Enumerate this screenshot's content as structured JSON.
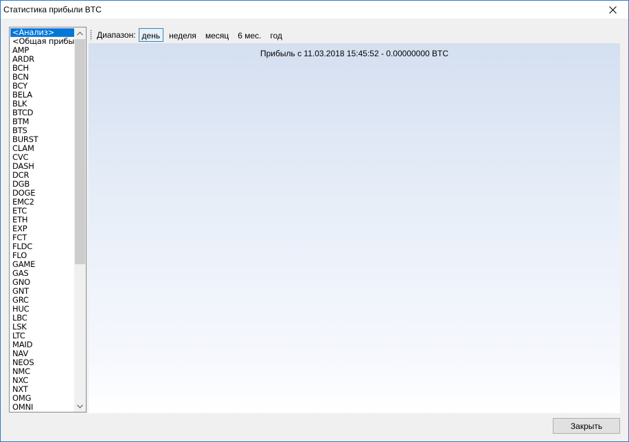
{
  "window": {
    "title": "Статистика прибыли BTC"
  },
  "icons": {
    "close": "close-icon",
    "scroll_up": "chevron-up-icon",
    "scroll_down": "chevron-down-icon",
    "grip": "toolbar-grip-icon"
  },
  "list": {
    "selected_index": 0,
    "items": [
      "<Анализ>",
      "<Общая прибыль>",
      "AMP",
      "ARDR",
      "BCH",
      "BCN",
      "BCY",
      "BELA",
      "BLK",
      "BTCD",
      "BTM",
      "BTS",
      "BURST",
      "CLAM",
      "CVC",
      "DASH",
      "DCR",
      "DGB",
      "DOGE",
      "EMC2",
      "ETC",
      "ETH",
      "EXP",
      "FCT",
      "FLDC",
      "FLO",
      "GAME",
      "GAS",
      "GNO",
      "GNT",
      "GRC",
      "HUC",
      "LBC",
      "LSK",
      "LTC",
      "MAID",
      "NAV",
      "NEOS",
      "NMC",
      "NXC",
      "NXT",
      "OMG",
      "OMNI"
    ]
  },
  "toolbar": {
    "range_label": "Диапазон:",
    "buttons": [
      "день",
      "неделя",
      "месяц",
      "6 мес.",
      "год"
    ],
    "active_index": 0
  },
  "chart": {
    "caption": "Прибыль с 11.03.2018 15:45:52 - 0.00000000 BTC"
  },
  "footer": {
    "close_label": "Закрыть"
  },
  "colors": {
    "selection": "#0078d7",
    "window_border": "#2b79c9",
    "chart_gradient_top": "#d4dff0",
    "chart_gradient_bottom": "#ffffff"
  }
}
